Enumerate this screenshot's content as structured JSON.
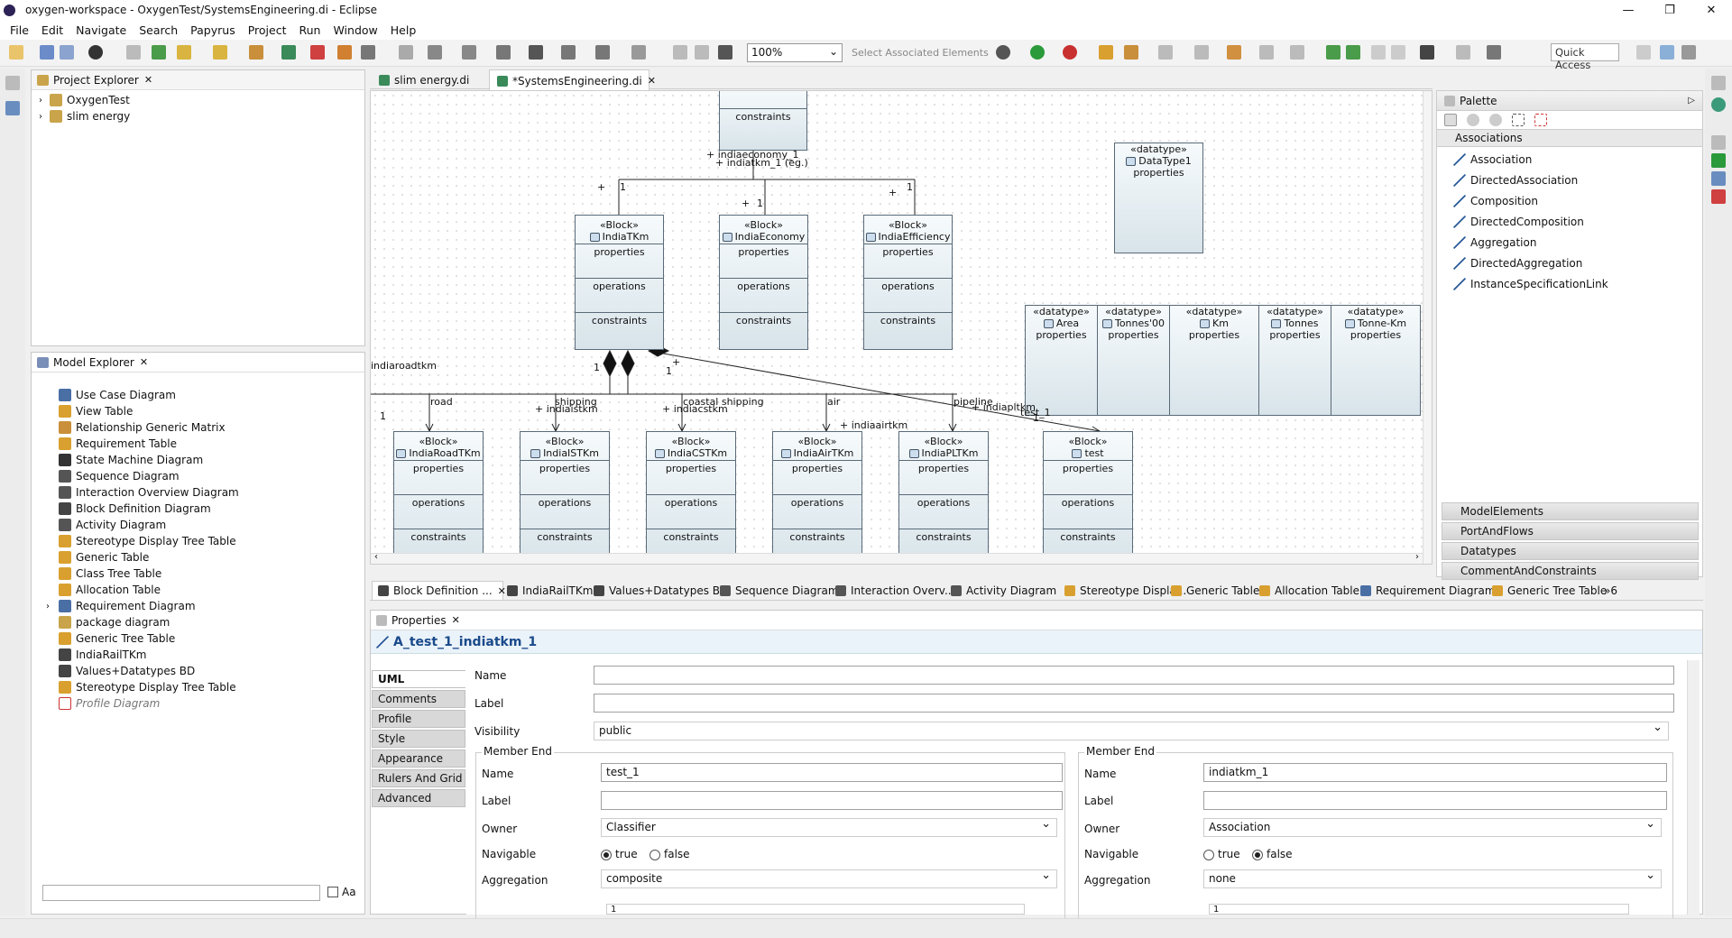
{
  "window": {
    "title": "oxygen-workspace - OxygenTest/SystemsEngineering.di - Eclipse"
  },
  "menu": [
    "File",
    "Edit",
    "Navigate",
    "Search",
    "Papyrus",
    "Project",
    "Run",
    "Window",
    "Help"
  ],
  "toolbar": {
    "zoom": "100%",
    "select_assoc": "Select Associated Elements",
    "quick_access": "Quick Access"
  },
  "project_explorer": {
    "title": "Project Explorer",
    "items": [
      "OxygenTest",
      "slim energy"
    ]
  },
  "model_explorer": {
    "title": "Model Explorer",
    "items": [
      "Use Case Diagram",
      "View Table",
      "Relationship Generic Matrix",
      "Requirement Table",
      "State Machine Diagram",
      "Sequence Diagram",
      "Interaction Overview Diagram",
      "Block Definition Diagram",
      "Activity Diagram",
      "Stereotype Display Tree Table",
      "Generic Table",
      "Class Tree Table",
      "Allocation Table",
      "Requirement Diagram",
      "package diagram",
      "Generic Tree Table",
      "IndiaRailTKm",
      "Values+Datatypes BD",
      "Stereotype Display Tree Table",
      "Profile Diagram"
    ],
    "filter_case": "Aa"
  },
  "editor_tabs": [
    "slim energy.di",
    "*SystemsEngineering.di"
  ],
  "diagram": {
    "stereo_block": "«Block»",
    "stereo_datatype": "«datatype»",
    "sec_properties": "properties",
    "sec_operations": "operations",
    "sec_constraints": "constraints",
    "top_blocks": [
      "IndiaTKm",
      "IndiaEconomy",
      "IndiaEfficiency"
    ],
    "bottom_blocks": [
      "IndiaRoadTKm",
      "IndiaISTKm",
      "IndiaCSTKm",
      "IndiaAirTKm",
      "IndiaPLTKm",
      "test"
    ],
    "datatypes": [
      "Area",
      "Tonnes'00",
      "Km",
      "Tonnes",
      "Tonne-Km"
    ],
    "datatype1": "DataType1",
    "labels": {
      "indiaroadtkm": "indiaroadtkm",
      "road": "road",
      "shipping": "shipping",
      "indiaistkm": "+ indiaistkm",
      "coastal": "coastal shipping",
      "indiacstkm": "+ indiacstkm",
      "air": "air",
      "indiaairtkm": "+ indiaairtkm",
      "pipeline": "pipeline",
      "indiapltkm": "+ indiapltkm",
      "test1": "test_1",
      "one": "1",
      "plus": "+",
      "top_overlap1": "+ indiaeconomy_1",
      "top_overlap2": "+ indiatkm_1 (eg.)"
    }
  },
  "bottom_tabs": [
    "Block Definition ...",
    "IndiaRailTKm",
    "Values+Datatypes BD",
    "Sequence Diagram",
    "Interaction Overv...",
    "Activity Diagram",
    "Stereotype Displa...",
    "Generic Table",
    "Allocation Table",
    "Requirement Diagram",
    "Generic Tree Table"
  ],
  "bottom_tabs_more": "»6",
  "palette": {
    "title": "Palette",
    "section": "Associations",
    "items": [
      "Association",
      "DirectedAssociation",
      "Composition",
      "DirectedComposition",
      "Aggregation",
      "DirectedAggregation",
      "InstanceSpecificationLink"
    ],
    "categories": [
      "ModelElements",
      "PortAndFlows",
      "Datatypes",
      "CommentAndConstraints"
    ]
  },
  "properties": {
    "title": "Properties",
    "element": "A_test_1_indiatkm_1",
    "tabs": [
      "UML",
      "Comments",
      "Profile",
      "Style",
      "Appearance",
      "Rulers And Grid",
      "Advanced"
    ],
    "name_label": "Name",
    "label_label": "Label",
    "visibility_label": "Visibility",
    "visibility": "public",
    "name": "",
    "label": "",
    "member_end_title": "Member End",
    "owner_label": "Owner",
    "navigable_label": "Navigable",
    "aggregation_label": "Aggregation",
    "true_label": "true",
    "false_label": "false",
    "multiplicity_value": "1",
    "end1": {
      "name": "test_1",
      "label": "",
      "owner": "Classifier",
      "navigable": true,
      "aggregation": "composite"
    },
    "end2": {
      "name": "indiatkm_1",
      "label": "",
      "owner": "Association",
      "navigable": false,
      "aggregation": "none"
    }
  }
}
